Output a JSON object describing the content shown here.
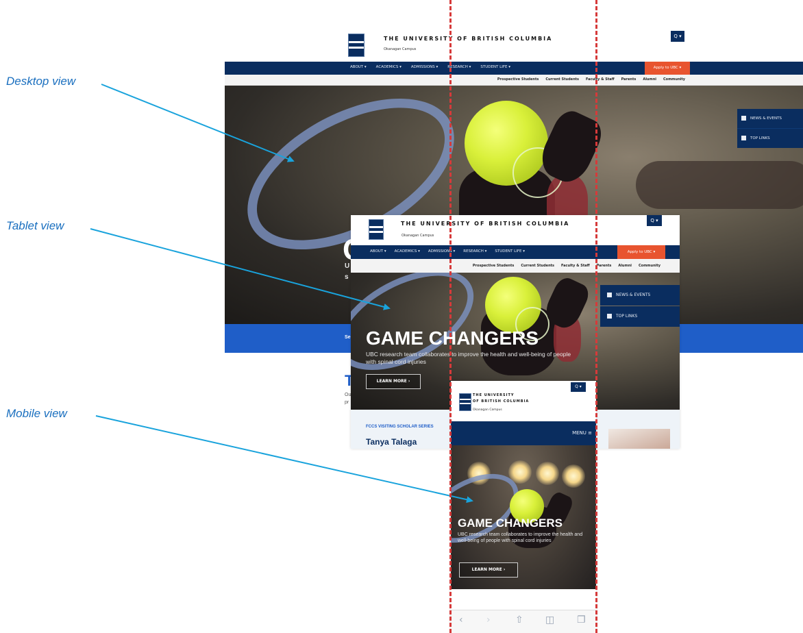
{
  "callouts": {
    "desktop": "Desktop view",
    "tablet": "Tablet view",
    "mobile": "Mobile view"
  },
  "site": {
    "university": "THE UNIVERSITY OF BRITISH COLUMBIA",
    "mobile_university_line1": "THE UNIVERSITY",
    "mobile_university_line2": "OF BRITISH COLUMBIA",
    "campus": "Okanagan Campus",
    "search_label": "Q ▾",
    "nav": [
      "ABOUT ▾",
      "ACADEMICS ▾",
      "ADMISSIONS ▾",
      "RESEARCH ▾",
      "STUDENT LIFE ▾"
    ],
    "apply": "Apply to UBC ▾",
    "audience": [
      "Prospective Students",
      "Current Students",
      "Faculty & Staff",
      "Parents",
      "Alumni",
      "Community"
    ],
    "side_links": [
      "NEWS & EVENTS",
      "TOP LINKS"
    ],
    "menu_label": "MENU ≡"
  },
  "desktop": {
    "hero_title_fragment": "G",
    "hero_sub_fragment_1": "U",
    "hero_sub_fragment_2": "s",
    "bar_text": "Se",
    "lower_heading_fragment": "T",
    "lower_text_1": "Ou",
    "lower_text_2": "pr"
  },
  "tablet": {
    "hero_title": "GAME CHANGERS",
    "hero_sub": "UBC research team collaborates to improve the health and well-being of people with spinal cord injuries",
    "learn_more": "LEARN MORE ›",
    "series_label": "FCCS VISITING SCHOLAR SERIES",
    "speaker": "Tanya Talaga"
  },
  "mobile": {
    "hero_title": "GAME CHANGERS",
    "hero_sub": "UBC research team collaborates to improve the health and well-being of people with spinal cord injuries",
    "learn_more": "LEARN MORE ›",
    "browser_icons": [
      "‹",
      "›",
      "⇧",
      "◫",
      "❐"
    ]
  },
  "colors": {
    "ubc_navy": "#0a2d5f",
    "apply_orange": "#e8542f",
    "callout_blue": "#1a6fbf",
    "guide_red": "#d63a3a",
    "bar_blue": "#1f5ec8"
  }
}
